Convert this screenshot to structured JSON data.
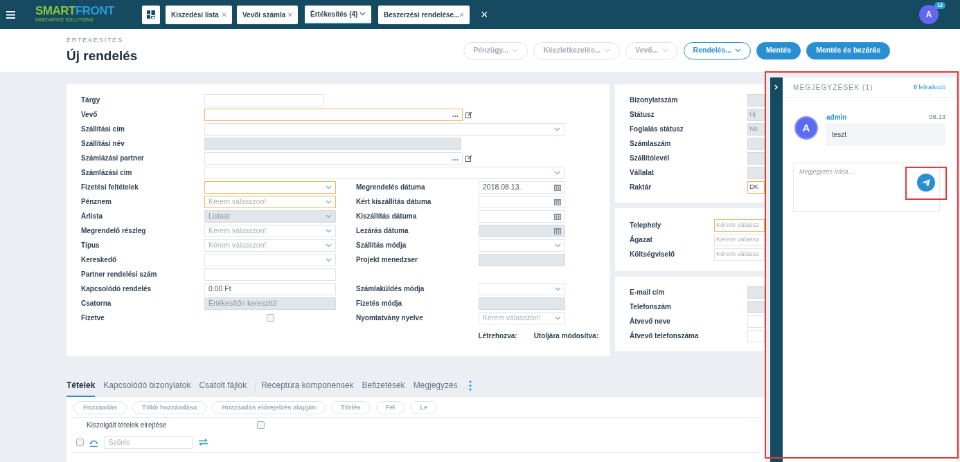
{
  "top_bar": {
    "logo_parts": [
      "SMART",
      "FRONT"
    ],
    "tagline": "INNOVATIVE SOLUTIONS",
    "tabs": [
      {
        "label": "Kiszedési lista",
        "selected": false,
        "close": "×"
      },
      {
        "label": "Vevői számla",
        "selected": false,
        "close": "×"
      },
      {
        "label": "Értékesítés (4)",
        "selected": true
      },
      {
        "label": "Beszerzési rendelése...",
        "selected": false,
        "close": "×"
      }
    ],
    "close_all": "×",
    "user_initial": "A",
    "notification_count": "13"
  },
  "header": {
    "breadcrumb": "ÉRTÉKESÍTÉS",
    "title": "Új rendelés",
    "buttons": [
      {
        "label": "Pénzügy...",
        "kind": "dropdown",
        "disabled": true
      },
      {
        "label": "Készletkezelés...",
        "kind": "dropdown",
        "disabled": true
      },
      {
        "label": "Vevő...",
        "kind": "dropdown",
        "disabled": true
      },
      {
        "label": "Rendelés...",
        "kind": "dropdown",
        "disabled": false
      },
      {
        "label": "Mentés",
        "kind": "primary"
      },
      {
        "label": "Mentés és bezárás",
        "kind": "primary"
      }
    ]
  },
  "form": {
    "top_fields": [
      {
        "label": "Tárgy",
        "kind": "text",
        "disabled": false,
        "highlighted": false
      },
      {
        "label": "Vevő",
        "kind": "lookup",
        "dots": "...",
        "disabled": false,
        "highlighted": true
      },
      {
        "label": "Szállítási cím",
        "kind": "select",
        "disabled": false,
        "highlighted": false
      },
      {
        "label": "Szállítási név",
        "kind": "text",
        "disabled": true,
        "highlighted": false
      },
      {
        "label": "Számlázási partner",
        "kind": "lookup",
        "dots": "...",
        "disabled": false,
        "highlighted": false
      },
      {
        "label": "Számlázási cím",
        "kind": "select",
        "disabled": false,
        "highlighted": false
      }
    ],
    "left_fields": [
      {
        "label": "Fizetési feltételek",
        "kind": "select",
        "disabled": false,
        "highlighted": true
      },
      {
        "label": "Pénznem",
        "kind": "select",
        "placeholder": "Kérem válasszon!",
        "disabled": false,
        "highlighted": true
      },
      {
        "label": "Árlista",
        "kind": "select",
        "value": "Listaár",
        "disabled": true,
        "highlighted": false
      },
      {
        "label": "Megrendelő részleg",
        "kind": "select",
        "placeholder": "Kérem válasszon!",
        "disabled": false,
        "highlighted": false
      },
      {
        "label": "Típus",
        "kind": "select",
        "placeholder": "Kérem válasszon!",
        "disabled": false,
        "highlighted": false
      },
      {
        "label": "Kereskedő",
        "kind": "select",
        "disabled": false,
        "highlighted": false
      },
      {
        "label": "Partner rendelési szám",
        "kind": "text",
        "disabled": false,
        "highlighted": false
      },
      {
        "label": "Kapcsolódó rendelés",
        "kind": "text",
        "value": "0.00 Ft",
        "disabled": false,
        "highlighted": false
      },
      {
        "label": "Csatorna",
        "kind": "text",
        "value": "Értékesítőn keresztül",
        "disabled": true,
        "highlighted": false
      },
      {
        "label": "Fizetve",
        "kind": "checkbox",
        "checked": false
      }
    ],
    "right_fields": [
      {
        "label": "Megrendelés dátuma",
        "kind": "date",
        "value": "2018.08.13.",
        "disabled": false,
        "highlighted": false
      },
      {
        "label": "Kért kiszállítás dátuma",
        "kind": "date",
        "disabled": false,
        "highlighted": false
      },
      {
        "label": "Kiszállítás dátuma",
        "kind": "date",
        "disabled": false,
        "highlighted": false
      },
      {
        "label": "Lezárás dátuma",
        "kind": "date",
        "disabled": true,
        "highlighted": false
      },
      {
        "label": "Szállítás módja",
        "kind": "select",
        "disabled": false,
        "highlighted": false
      },
      {
        "label": "Projekt menedzser",
        "kind": "text",
        "disabled": true,
        "highlighted": false
      },
      {
        "kind": "gap"
      },
      {
        "label": "Számlaküldés módja",
        "kind": "select",
        "disabled": false,
        "highlighted": false
      },
      {
        "label": "Fizetés módja",
        "kind": "text",
        "disabled": true,
        "highlighted": false
      },
      {
        "label": "Nyomtatvány nyelve",
        "kind": "select",
        "placeholder": "Kérem válasszon!",
        "disabled": false,
        "highlighted": false
      }
    ],
    "created_label": "Létrehozva:",
    "modified_label": "Utoljára módosítva:"
  },
  "side_cards": [
    [
      {
        "label": "Bizonylatszám",
        "kind": "text",
        "disabled": true,
        "highlighted": false
      },
      {
        "label": "Státusz",
        "kind": "text",
        "value": "Új",
        "disabled": true,
        "highlighted": false
      },
      {
        "label": "Foglalás státusz",
        "kind": "text",
        "value": "Ne",
        "disabled": true,
        "highlighted": false
      },
      {
        "label": "Számlaszám",
        "kind": "text",
        "disabled": true,
        "highlighted": false
      },
      {
        "label": "Szállítólevél",
        "kind": "text",
        "disabled": true,
        "highlighted": false
      },
      {
        "label": "Vállalat",
        "kind": "text",
        "disabled": true,
        "highlighted": false
      },
      {
        "label": "Raktár",
        "kind": "text",
        "value": "DK",
        "disabled": false,
        "highlighted": true
      }
    ],
    [
      {
        "label": "Telephely",
        "kind": "text",
        "placeholder": "Kérem válassz",
        "disabled": false,
        "highlighted": true
      },
      {
        "label": "Ágazat",
        "kind": "text",
        "placeholder": "Kérem válassz",
        "disabled": false,
        "highlighted": false
      },
      {
        "label": "Költségviselő",
        "kind": "text",
        "placeholder": "Kérem válassz",
        "disabled": false,
        "highlighted": false
      }
    ],
    [
      {
        "label": "E-mail cím",
        "kind": "text",
        "disabled": true,
        "highlighted": false
      },
      {
        "label": "Telefonszám",
        "kind": "text",
        "disabled": true,
        "highlighted": false
      },
      {
        "label": "Átvevő neve",
        "kind": "text",
        "disabled": false,
        "highlighted": false
      },
      {
        "label": "Átvevő telefonszáma",
        "kind": "text",
        "disabled": false,
        "highlighted": false
      }
    ]
  ],
  "bottom_tabs": [
    {
      "label": "Tételek",
      "selected": true
    },
    {
      "label": "Kapcsolódó bizonylatok",
      "selected": false
    },
    {
      "label": "Csatolt fájlok",
      "selected": false
    },
    {
      "label": "Receptúra komponensek",
      "selected": false
    },
    {
      "label": "Befizetések",
      "selected": false
    },
    {
      "label": "Megjegyzés",
      "selected": false
    }
  ],
  "item_buttons": [
    {
      "label": "Hozzáadás",
      "disabled": true
    },
    {
      "label": "Több hozzáadása",
      "disabled": true
    },
    {
      "label": "Hozzáadás előrejelzés alapján",
      "disabled": true
    },
    {
      "label": "Törlés",
      "disabled": true
    },
    {
      "label": "Fel",
      "disabled": true
    },
    {
      "label": "Le",
      "disabled": true
    }
  ],
  "hide_served": {
    "label": "Kiszolgált tételek elrejtése",
    "checked": false
  },
  "filter": {
    "select_all_checked": false,
    "placeholder": "Szűrés"
  },
  "notes_panel": {
    "title": "MEGJEGYZÉSEK (1)",
    "subscriber_count": "0",
    "subscriber_label": "feliratkozó",
    "comments": [
      {
        "initial": "A",
        "author": "admin",
        "time": "08.13",
        "text": "teszt"
      }
    ],
    "input_placeholder": "Megjegyzés írása..."
  }
}
